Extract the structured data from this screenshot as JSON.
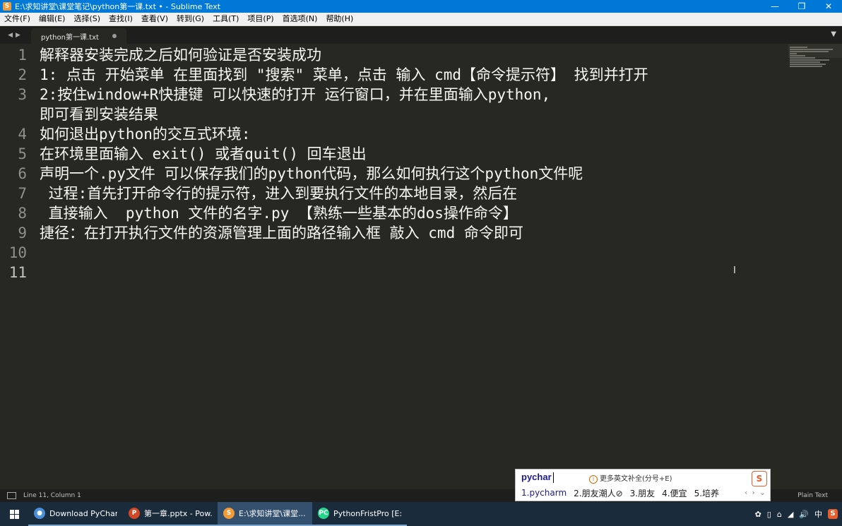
{
  "window": {
    "title": "E:\\求知讲堂\\课堂笔记\\python第一课.txt • - Sublime Text",
    "app_icon": "S",
    "controls": [
      "—",
      "❐",
      "✕"
    ]
  },
  "menu": {
    "items": [
      "文件(F)",
      "编辑(E)",
      "选择(S)",
      "查找(I)",
      "查看(V)",
      "转到(G)",
      "工具(T)",
      "项目(P)",
      "首选项(N)",
      "帮助(H)"
    ]
  },
  "tabs": [
    {
      "label": "python第一课.txt",
      "dirty": true,
      "active": true
    }
  ],
  "tab_nav": [
    "◀",
    "▶"
  ],
  "tab_menu_icon": "▼",
  "editor": {
    "lines": [
      {
        "num": "1",
        "text": "解释器安装完成之后如何验证是否安装成功"
      },
      {
        "num": "2",
        "text": "1: 点击 开始菜单 在里面找到 \"搜索\" 菜单，点击 输入 cmd【命令提示符】 找到并打开"
      },
      {
        "num": "3",
        "text": "2:按住window+R快捷键 可以快速的打开 运行窗口，并在里面输入python,"
      },
      {
        "num": "",
        "text": "即可看到安装结果"
      },
      {
        "num": "4",
        "text": "如何退出python的交互式环境:"
      },
      {
        "num": "5",
        "text": "在环境里面输入 exit() 或者quit() 回车退出"
      },
      {
        "num": "6",
        "text": "声明一个.py文件 可以保存我们的python代码，那么如何执行这个python文件呢"
      },
      {
        "num": "7",
        "text": " 过程:首先打开命令行的提示符，进入到要执行文件的本地目录，然后在"
      },
      {
        "num": "8",
        "text": " 直接输入  python 文件的名字.py 【熟练一些基本的dos操作命令】"
      },
      {
        "num": "9",
        "text": "捷径：在打开执行文件的资源管理上面的路径输入框 敲入 cmd 命令即可"
      },
      {
        "num": "10",
        "text": ""
      },
      {
        "num": "11",
        "text": ""
      }
    ],
    "active_line": "11",
    "cursor_glyph": "I"
  },
  "status": {
    "position": "Line 11, Column 1",
    "syntax": "Plain Text"
  },
  "ime": {
    "composition": "pychar",
    "hint_icon": "i",
    "hint": "更多英文补全(分号+E)",
    "logo": "S",
    "candidates": [
      "1.pycharm",
      "2.朋友潮人⊘",
      "3.朋友",
      "4.便宜",
      "5.培养"
    ],
    "pager": [
      "‹",
      "›",
      "⌄"
    ]
  },
  "taskbar": {
    "tasks": [
      {
        "label": "Download PyChar...",
        "icon": "●",
        "color": "#4a8fd8",
        "active": false
      },
      {
        "label": "第一章.pptx - Pow...",
        "icon": "P",
        "color": "#d24726",
        "active": false
      },
      {
        "label": "E:\\求知讲堂\\课堂...",
        "icon": "S",
        "color": "#f29a36",
        "active": true
      },
      {
        "label": "PythonFristPro [E:...",
        "icon": "PC",
        "color": "#21d789",
        "active": false
      }
    ],
    "tray": {
      "icons": [
        "✿",
        "▯",
        "⌂",
        "◢",
        "🔊"
      ],
      "lang": "中",
      "sogou": "S"
    }
  },
  "colors": {
    "editor_bg": "#272822",
    "text": "#f8f8f2",
    "gutter_text": "#8f908a",
    "titlebar": "#0078d7",
    "taskbar": "#1a2b3c"
  }
}
